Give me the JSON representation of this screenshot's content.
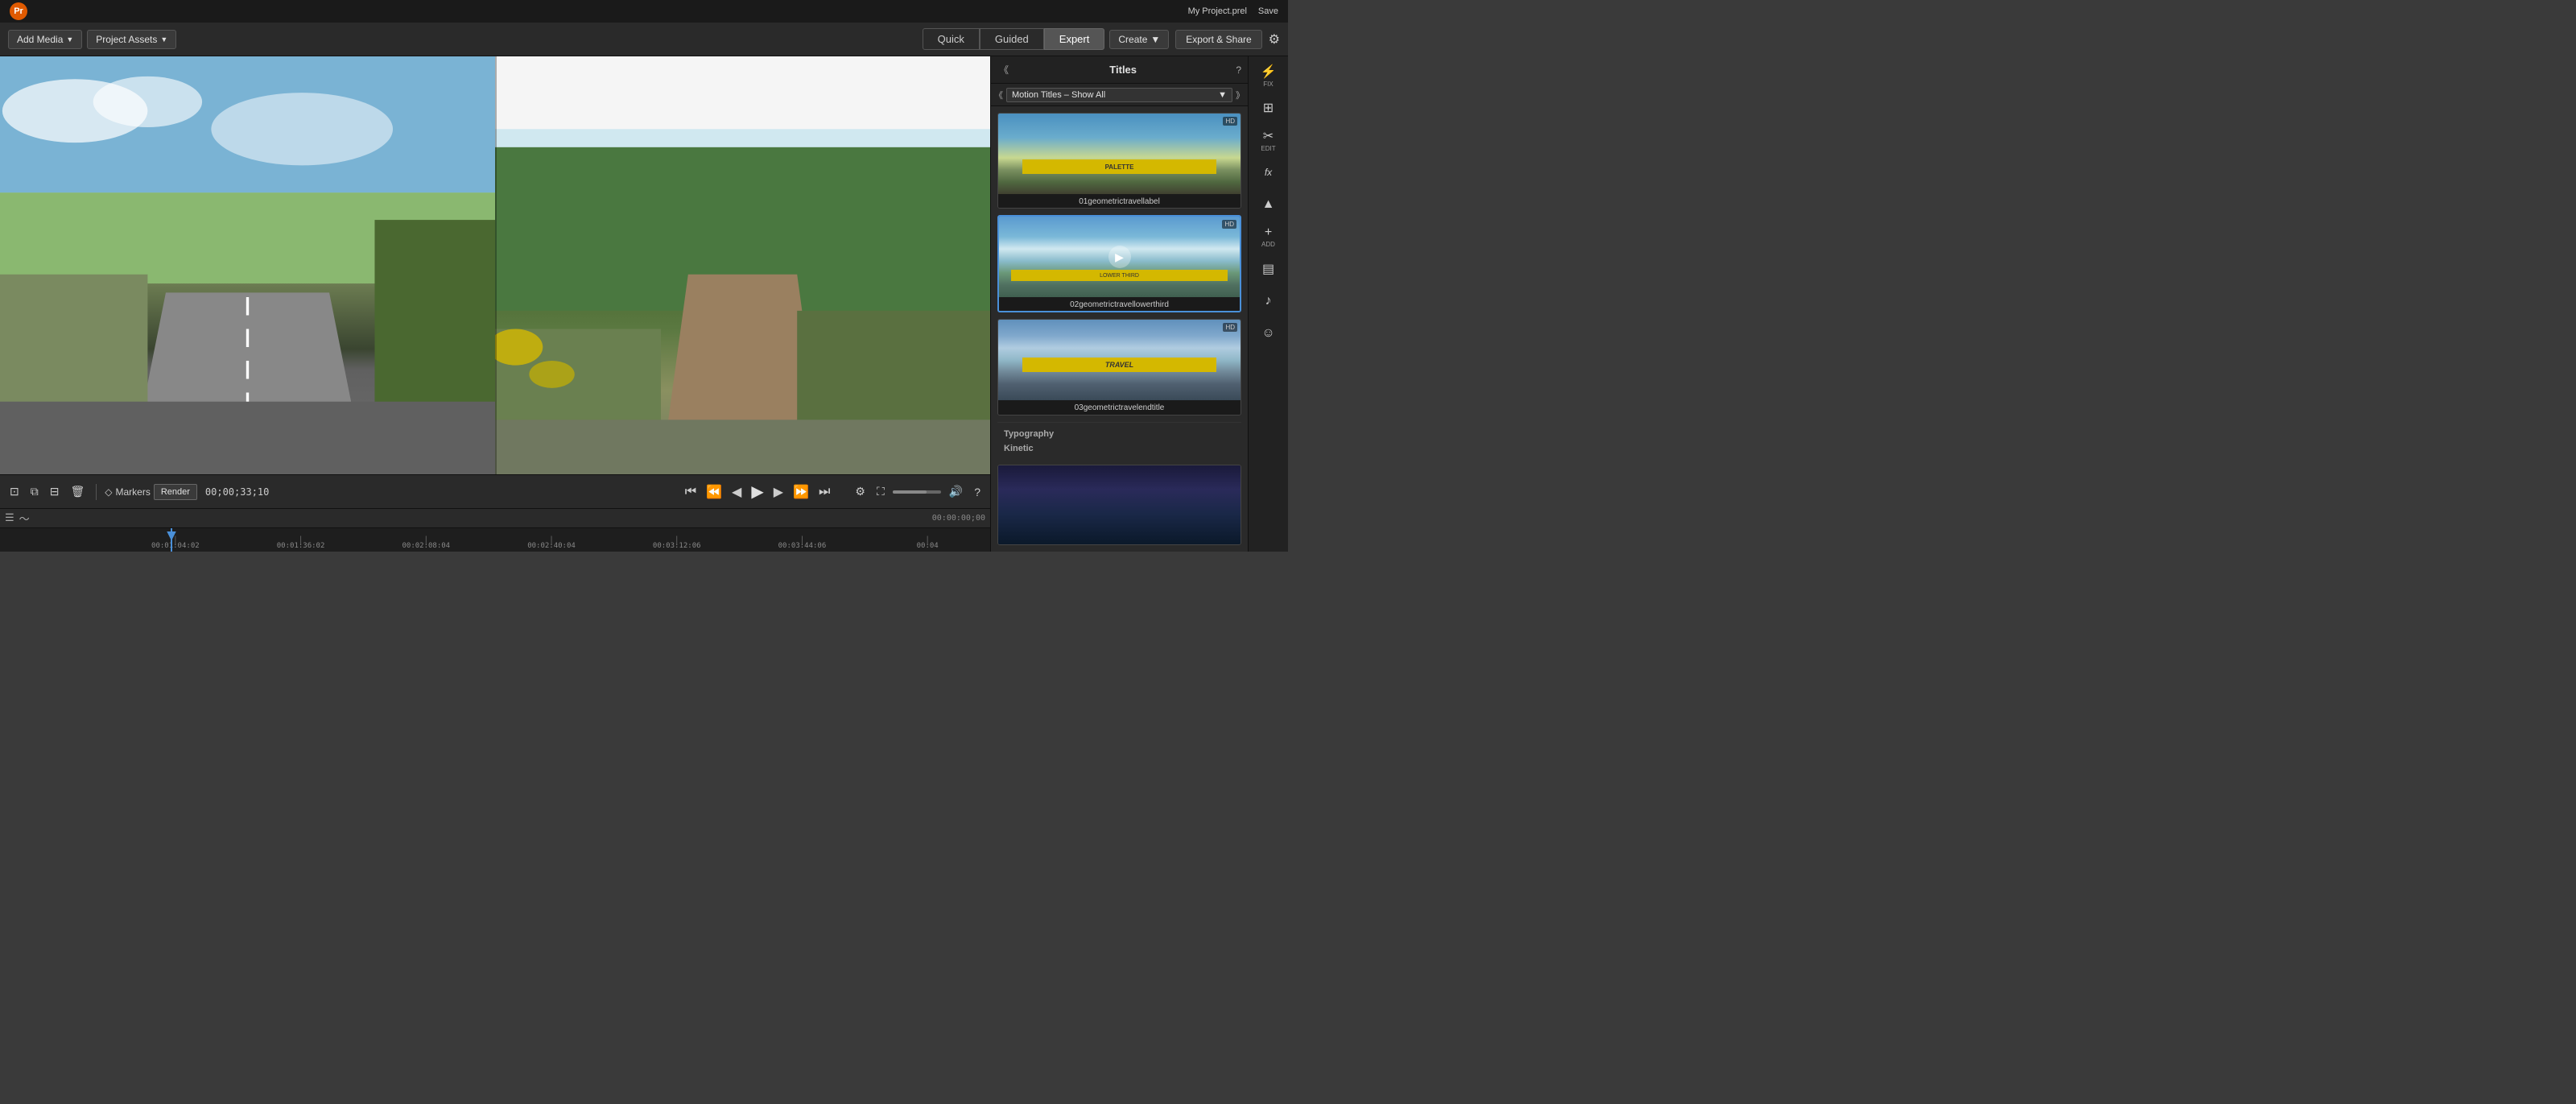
{
  "topbar": {
    "project_name": "My Project.prel",
    "save_label": "Save"
  },
  "toolbar": {
    "add_media_label": "Add Media",
    "project_assets_label": "Project Assets",
    "mode_quick": "Quick",
    "mode_guided": "Guided",
    "mode_expert": "Expert",
    "create_label": "Create",
    "export_label": "Export & Share"
  },
  "controls": {
    "markers_label": "Markers",
    "render_label": "Render",
    "timecode": "00;00;33;10"
  },
  "timeline": {
    "marks": [
      "00:00:00;00",
      "00:01:04:02",
      "00:01:36:02",
      "00:02:08:04",
      "00:02:40:04",
      "00:03:12:06",
      "00:03:44:06",
      "00:04"
    ]
  },
  "right_panel": {
    "title": "Titles",
    "filter_label": "Motion Titles – Show All",
    "items": [
      {
        "id": "item1",
        "name": "01geometrictravellabel",
        "selected": false
      },
      {
        "id": "item2",
        "name": "02geometrictravellowerthird",
        "selected": true
      },
      {
        "id": "item3",
        "name": "03geometrictravelendtitle",
        "selected": false
      }
    ],
    "categories": [
      "Typography",
      "Kinetic"
    ]
  },
  "side_tools": [
    {
      "id": "fix",
      "label": "FIX",
      "icon": "⚡"
    },
    {
      "id": "adjust",
      "label": "",
      "icon": "⊞"
    },
    {
      "id": "edit",
      "label": "EDIT",
      "icon": "✂"
    },
    {
      "id": "effects",
      "label": "",
      "icon": "fx"
    },
    {
      "id": "color",
      "label": "",
      "icon": "▲"
    },
    {
      "id": "add",
      "label": "ADD",
      "icon": "+"
    },
    {
      "id": "timeline",
      "label": "",
      "icon": "▤"
    },
    {
      "id": "music",
      "label": "",
      "icon": "♪"
    },
    {
      "id": "emoji",
      "label": "",
      "icon": "☺"
    }
  ]
}
